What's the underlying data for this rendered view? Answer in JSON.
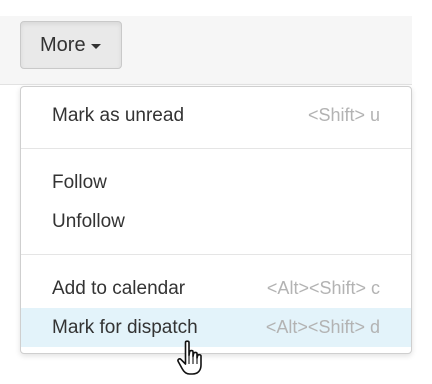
{
  "toolbar": {
    "more_label": "More"
  },
  "menu": {
    "items": [
      {
        "label": "Mark as unread",
        "shortcut": "<Shift> u"
      },
      {
        "label": "Follow",
        "shortcut": ""
      },
      {
        "label": "Unfollow",
        "shortcut": ""
      },
      {
        "label": "Add to calendar",
        "shortcut": "<Alt><Shift> c"
      },
      {
        "label": "Mark for dispatch",
        "shortcut": "<Alt><Shift> d"
      }
    ]
  },
  "icons": {
    "caret": "chevron-down-icon",
    "cursor": "hand-pointer-icon"
  },
  "colors": {
    "hover_background": "#e3f3fa",
    "shortcut_text": "#b3b3b3",
    "button_background": "#e9e9e9"
  }
}
